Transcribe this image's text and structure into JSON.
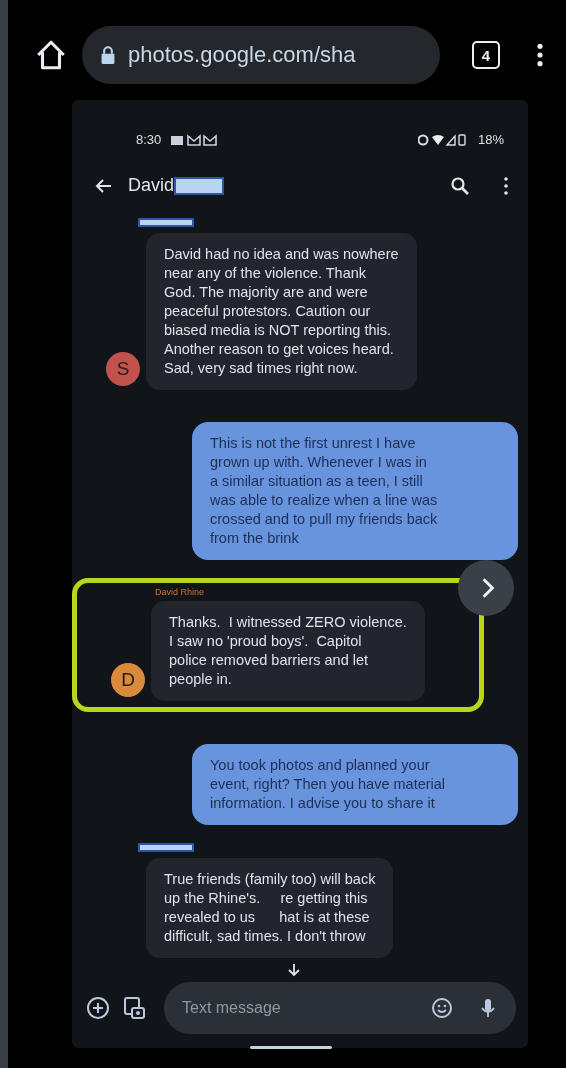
{
  "browser": {
    "url": "photos.google.com/sha",
    "tab_count": "4"
  },
  "status_bar": {
    "time": "8:30",
    "battery": "18%"
  },
  "header": {
    "title": "David"
  },
  "messages": [
    {
      "kind": "incoming",
      "redacted_sender": true,
      "avatar": "S",
      "color": "#c2524c",
      "highlighted": false,
      "lines": [
        "David had no idea and was nowhere",
        "near any of the violence. Thank",
        "God. The majority are and were",
        "peaceful protestors. Caution our",
        "biased media is NOT reporting this.",
        "Another reason to get voices heard.",
        "Sad, very sad times right now."
      ]
    },
    {
      "kind": "outgoing",
      "highlighted": false,
      "lines": [
        "This is not the first unrest I have",
        "grown up with. Whenever I was in",
        "a similar situation as a teen, I still",
        "was able to realize when a line was",
        "crossed and to pull my friends back",
        "from the brink"
      ]
    },
    {
      "kind": "incoming",
      "sender": "David Rhine",
      "avatar": "D",
      "color": "#d98a3a",
      "highlighted": true,
      "lines": [
        "Thanks.  I witnessed ZERO violence.",
        "I saw no 'proud boys'.  Capitol",
        "police removed barriers and let",
        "people in."
      ]
    },
    {
      "kind": "outgoing",
      "highlighted": false,
      "lines": [
        "You took photos and planned your",
        "event, right? Then you have material",
        "information. I advise you to share it"
      ]
    },
    {
      "kind": "incoming",
      "redacted_sender": true,
      "highlighted": false,
      "lines": [
        "True friends (family too) will back",
        "up the Rhine's.     re getting this",
        "revealed to us      hat is at these",
        "difficult, sad times. I don't throw"
      ]
    }
  ],
  "compose": {
    "placeholder": "Text message"
  }
}
